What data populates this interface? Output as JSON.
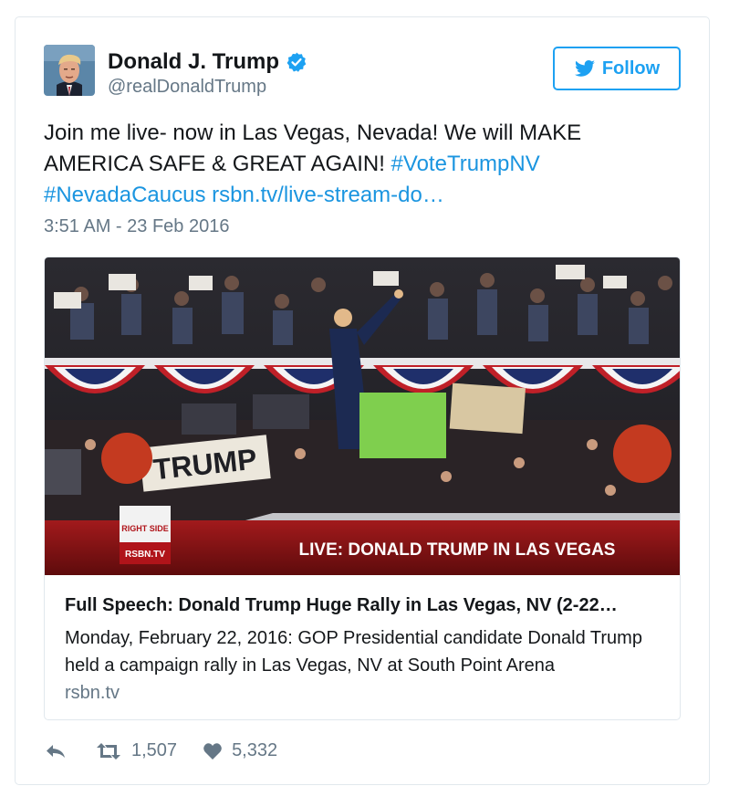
{
  "author": {
    "name": "Donald J. Trump",
    "handle": "@realDonaldTrump",
    "verified": true
  },
  "follow_button": {
    "label": "Follow"
  },
  "tweet": {
    "text_plain": "Join me live- now in Las Vegas, Nevada! We will MAKE AMERICA SAFE & GREAT AGAIN! ",
    "hashtag_1": "#VoteTrumpNV",
    "hashtag_2": "#NevadaCaucus",
    "link": "rsbn.tv/live-stream-do…",
    "timestamp": "3:51 AM - 23 Feb 2016"
  },
  "card": {
    "image_banner": "LIVE: DONALD TRUMP IN LAS VEGAS",
    "logo_line_1": "RIGHT SIDE",
    "logo_line_2": "RSBN.TV",
    "sign_text": "TRUMP",
    "title": "Full Speech: Donald Trump Huge Rally in Las Vegas, NV (2-22…",
    "description": "Monday, February 22, 2016: GOP Presidential candidate Donald Trump held a campaign rally in Las Vegas, NV at South Point Arena",
    "domain": "rsbn.tv"
  },
  "actions": {
    "retweets": "1,507",
    "likes": "5,332"
  },
  "colors": {
    "accent": "#1da1f2",
    "link": "#1b95e0",
    "secondary_text": "#657786",
    "border": "#e1e8ed"
  }
}
